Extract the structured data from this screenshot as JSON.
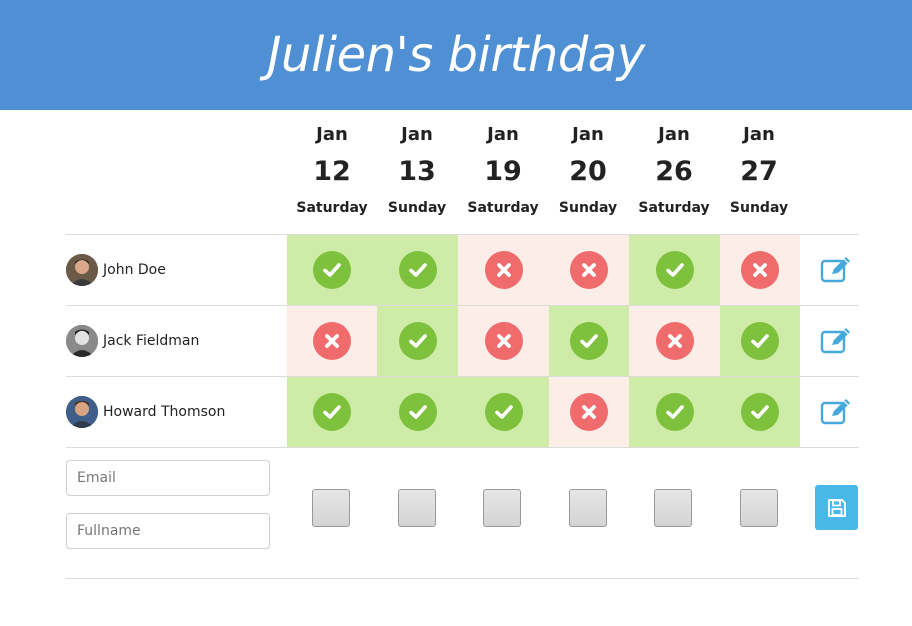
{
  "title": "Julien's birthday",
  "dates": [
    {
      "month": "Jan",
      "day": "12",
      "weekday": "Saturday"
    },
    {
      "month": "Jan",
      "day": "13",
      "weekday": "Sunday"
    },
    {
      "month": "Jan",
      "day": "19",
      "weekday": "Saturday"
    },
    {
      "month": "Jan",
      "day": "20",
      "weekday": "Sunday"
    },
    {
      "month": "Jan",
      "day": "26",
      "weekday": "Saturday"
    },
    {
      "month": "Jan",
      "day": "27",
      "weekday": "Sunday"
    }
  ],
  "participants": [
    {
      "name": "John Doe",
      "answers": [
        "yes",
        "yes",
        "no",
        "no",
        "yes",
        "no"
      ]
    },
    {
      "name": "Jack Fieldman",
      "answers": [
        "no",
        "yes",
        "no",
        "yes",
        "no",
        "yes"
      ]
    },
    {
      "name": "Howard Thomson",
      "answers": [
        "yes",
        "yes",
        "yes",
        "no",
        "yes",
        "yes"
      ]
    }
  ],
  "form": {
    "email_placeholder": "Email",
    "fullname_placeholder": "Fullname"
  },
  "icons": {
    "yes": "check-icon",
    "no": "cross-icon",
    "edit": "pencil-edit-icon",
    "save": "floppy-disk-icon"
  },
  "colors": {
    "header": "#4f8fd3",
    "yes_bg": "#cfeba8",
    "no_bg": "#fcede9",
    "yes_mark": "#7ec13c",
    "no_mark": "#f06b6b",
    "action": "#47b8e8"
  }
}
